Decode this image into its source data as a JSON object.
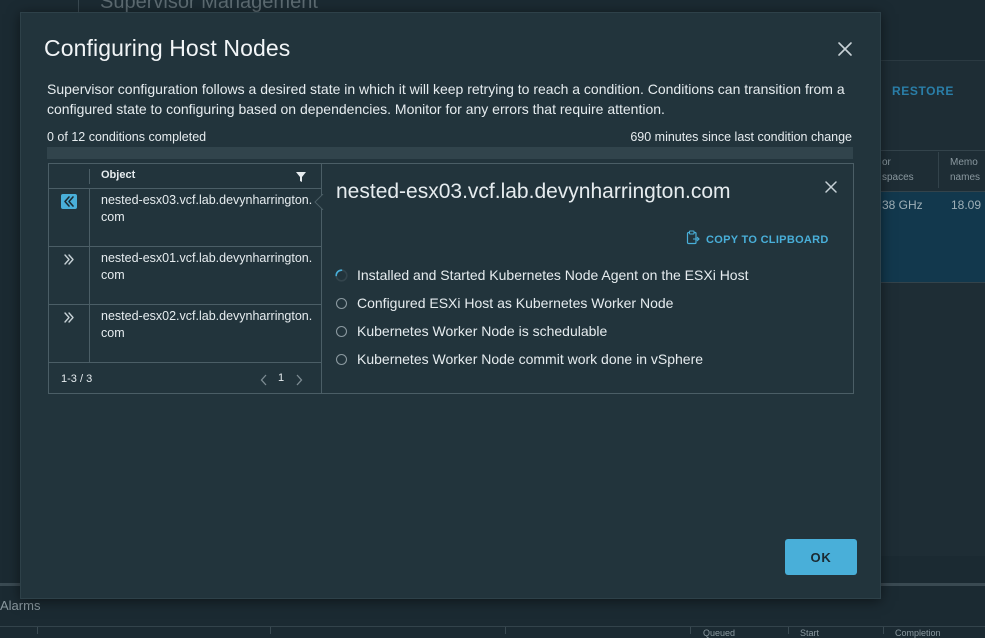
{
  "background": {
    "page_title": "Supervisor Management",
    "restore_label": "RESTORE",
    "col1_line1": "or",
    "col1_line2": "spaces",
    "col2_line1": "Memo",
    "col2_line2": "names",
    "cell1": "38 GHz",
    "cell2": "18.09",
    "alarms_label": "Alarms",
    "bottom_cols": [
      "Queued",
      "Start",
      "Completion"
    ]
  },
  "modal": {
    "title": "Configuring Host Nodes",
    "description": "Supervisor configuration follows a desired state in which it will keep retrying to reach a condition. Conditions can transition from a configured state to configuring based on dependencies. Monitor for any errors that require attention.",
    "progress_text": "0 of 12 conditions completed",
    "progress_time": "690 minutes since last condition change",
    "progress_fraction": 0,
    "ok_label": "OK"
  },
  "grid": {
    "column_header": "Object",
    "rows": [
      {
        "label": "nested-esx03.vcf.lab.devynharrington.com",
        "expanded": true
      },
      {
        "label": "nested-esx01.vcf.lab.devynharrington.com",
        "expanded": false
      },
      {
        "label": "nested-esx02.vcf.lab.devynharrington.com",
        "expanded": false
      }
    ],
    "range": "1-3 / 3",
    "page": "1"
  },
  "detail": {
    "title": "nested-esx03.vcf.lab.devynharrington.com",
    "copy_label": "COPY TO CLIPBOARD",
    "conditions": [
      {
        "text": "Installed and Started Kubernetes Node Agent on the ESXi Host",
        "status": "in-progress"
      },
      {
        "text": "Configured ESXi Host as Kubernetes Worker Node",
        "status": "pending"
      },
      {
        "text": "Kubernetes Worker Node is schedulable",
        "status": "pending"
      },
      {
        "text": "Kubernetes Worker Node commit work done in vSphere",
        "status": "pending"
      }
    ]
  },
  "colors": {
    "accent": "#49afd9",
    "modal_bg": "#22343c",
    "page_bg": "#1b2a32"
  }
}
